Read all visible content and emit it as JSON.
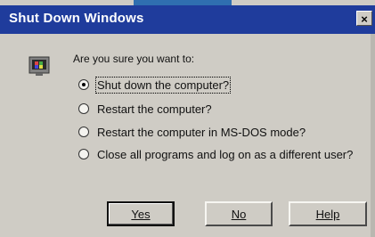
{
  "window": {
    "title": "Shut Down Windows",
    "close_glyph": "×"
  },
  "prompt": "Are you sure you want to:",
  "options": [
    {
      "label": "Shut down the computer?",
      "selected": true
    },
    {
      "label": "Restart the computer?",
      "selected": false
    },
    {
      "label": "Restart the computer in MS-DOS mode?",
      "selected": false
    },
    {
      "label": "Close all programs and log on as a different user?",
      "selected": false
    }
  ],
  "buttons": {
    "yes": "Yes",
    "no": "No",
    "help": "Help"
  },
  "icons": {
    "dialog_icon": "computer-shutdown-icon",
    "close_icon": "close-icon"
  },
  "colors": {
    "titlebar": "#1f3c9c",
    "dialog_bg": "#cfccc5"
  }
}
